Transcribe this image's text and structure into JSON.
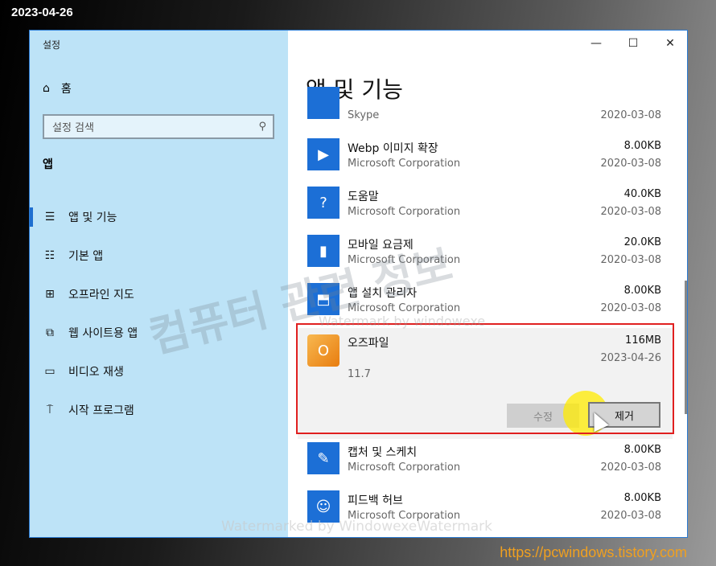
{
  "overlay": {
    "date": "2023-04-26",
    "url": "https://pcwindows.tistory.com",
    "watermark_big": "컴퓨터 관련 정보",
    "watermark_small": "Watermark by windowexe",
    "watermark_bottom": "Watermarked by WindowexeWatermark"
  },
  "window": {
    "title": "설정",
    "controls": {
      "minimize": "—",
      "maximize": "☐",
      "close": "✕"
    }
  },
  "sidebar": {
    "home_label": "홈",
    "search_placeholder": "설정 검색",
    "section_label": "앱",
    "items": [
      {
        "label": "앱 및 기능",
        "icon": "list-icon",
        "glyph": "☰",
        "active": true
      },
      {
        "label": "기본 앱",
        "icon": "default-apps-icon",
        "glyph": "☷",
        "active": false
      },
      {
        "label": "오프라인 지도",
        "icon": "map-icon",
        "glyph": "⊞",
        "active": false
      },
      {
        "label": "웹 사이트용 앱",
        "icon": "web-app-icon",
        "glyph": "⧉",
        "active": false
      },
      {
        "label": "비디오 재생",
        "icon": "video-icon",
        "glyph": "▭",
        "active": false
      },
      {
        "label": "시작 프로그램",
        "icon": "startup-icon",
        "glyph": "⍑",
        "active": false
      }
    ]
  },
  "main": {
    "title": "앱 및 기능",
    "apps": [
      {
        "name": "Skype",
        "publisher": "",
        "size": "",
        "date": "2020-03-08",
        "glyph": ""
      },
      {
        "name": "Webp 이미지 확장",
        "publisher": "Microsoft Corporation",
        "size": "8.00KB",
        "date": "2020-03-08",
        "glyph": "▶"
      },
      {
        "name": "도움말",
        "publisher": "Microsoft Corporation",
        "size": "40.0KB",
        "date": "2020-03-08",
        "glyph": "?"
      },
      {
        "name": "모바일 요금제",
        "publisher": "Microsoft Corporation",
        "size": "20.0KB",
        "date": "2020-03-08",
        "glyph": "▮"
      },
      {
        "name": "앱 설치 관리자",
        "publisher": "Microsoft Corporation",
        "size": "8.00KB",
        "date": "2020-03-08",
        "glyph": "⬒"
      }
    ],
    "selected_app": {
      "name": "오즈파일",
      "size": "116MB",
      "date": "2023-04-26",
      "version": "11.7",
      "modify_label": "수정",
      "remove_label": "제거",
      "glyph": "O"
    },
    "apps_after": [
      {
        "name": "캡처 및 스케치",
        "publisher": "Microsoft Corporation",
        "size": "8.00KB",
        "date": "2020-03-08",
        "glyph": "✎"
      },
      {
        "name": "피드백 허브",
        "publisher": "Microsoft Corporation",
        "size": "8.00KB",
        "date": "2020-03-08",
        "glyph": "☺"
      }
    ]
  }
}
